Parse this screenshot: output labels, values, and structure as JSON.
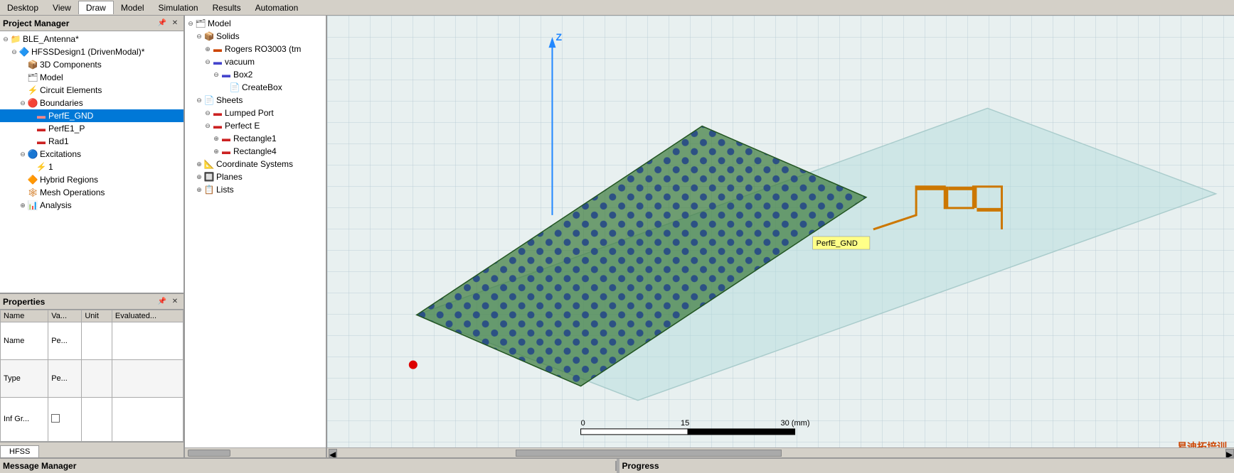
{
  "menubar": {
    "items": [
      "Desktop",
      "View",
      "Draw",
      "Model",
      "Simulation",
      "Results",
      "Automation"
    ]
  },
  "project_manager": {
    "title": "Project Manager",
    "icons": [
      "📌",
      "✕"
    ],
    "tree": [
      {
        "id": "ble_antenna",
        "label": "BLE_Antenna*",
        "indent": 0,
        "toggle": "minus",
        "icon": "folder",
        "icon_color": "blue"
      },
      {
        "id": "hfss_design",
        "label": "HFSSDesign1 (DrivenModal)*",
        "indent": 1,
        "toggle": "minus",
        "icon": "hfss",
        "icon_color": "blue"
      },
      {
        "id": "3d_components",
        "label": "3D Components",
        "indent": 2,
        "toggle": "none",
        "icon": "box",
        "icon_color": "gray"
      },
      {
        "id": "model",
        "label": "Model",
        "indent": 2,
        "toggle": "none",
        "icon": "model",
        "icon_color": "gray"
      },
      {
        "id": "circuit_elements",
        "label": "Circuit Elements",
        "indent": 2,
        "toggle": "none",
        "icon": "circuit",
        "icon_color": "gray"
      },
      {
        "id": "boundaries",
        "label": "Boundaries",
        "indent": 2,
        "toggle": "minus",
        "icon": "boundary",
        "icon_color": "red"
      },
      {
        "id": "perfe_gnd",
        "label": "PerfE_GND",
        "indent": 3,
        "toggle": "none",
        "icon": "sheet",
        "icon_color": "red",
        "selected": true
      },
      {
        "id": "perfe1_p",
        "label": "PerfE1_P",
        "indent": 3,
        "toggle": "none",
        "icon": "sheet",
        "icon_color": "red"
      },
      {
        "id": "rad1",
        "label": "Rad1",
        "indent": 3,
        "toggle": "none",
        "icon": "sheet",
        "icon_color": "red"
      },
      {
        "id": "excitations",
        "label": "Excitations",
        "indent": 2,
        "toggle": "minus",
        "icon": "excitation",
        "icon_color": "blue"
      },
      {
        "id": "exc_1",
        "label": "1",
        "indent": 3,
        "toggle": "none",
        "icon": "port",
        "icon_color": "red"
      },
      {
        "id": "hybrid_regions",
        "label": "Hybrid Regions",
        "indent": 2,
        "toggle": "none",
        "icon": "hybrid",
        "icon_color": "orange"
      },
      {
        "id": "mesh_operations",
        "label": "Mesh Operations",
        "indent": 2,
        "toggle": "none",
        "icon": "mesh",
        "icon_color": "orange"
      },
      {
        "id": "analysis",
        "label": "Analysis",
        "indent": 2,
        "toggle": "plus",
        "icon": "analysis",
        "icon_color": "blue"
      }
    ]
  },
  "properties": {
    "title": "Properties",
    "columns": [
      "Name",
      "Va...",
      "Unit",
      "Evaluated..."
    ],
    "rows": [
      {
        "name": "Name",
        "value": "Pe...",
        "unit": "",
        "evaluated": ""
      },
      {
        "type": "Type",
        "value": "Pe...",
        "unit": "",
        "evaluated": ""
      },
      {
        "name": "Inf Gr...",
        "value": "☐",
        "unit": "",
        "evaluated": ""
      }
    ]
  },
  "hfss_tab": {
    "label": "HFSS"
  },
  "model_tree": {
    "items": [
      {
        "id": "model_root",
        "label": "Model",
        "indent": 0,
        "toggle": "minus"
      },
      {
        "id": "solids",
        "label": "Solids",
        "indent": 1,
        "toggle": "minus"
      },
      {
        "id": "rogers",
        "label": "Rogers RO3003 (tm",
        "indent": 2,
        "toggle": "plus"
      },
      {
        "id": "vacuum",
        "label": "vacuum",
        "indent": 2,
        "toggle": "minus"
      },
      {
        "id": "box2",
        "label": "Box2",
        "indent": 3,
        "toggle": "minus"
      },
      {
        "id": "createbox",
        "label": "CreateBox",
        "indent": 4,
        "toggle": "none"
      },
      {
        "id": "sheets",
        "label": "Sheets",
        "indent": 1,
        "toggle": "minus"
      },
      {
        "id": "lumped_port",
        "label": "Lumped Port",
        "indent": 2,
        "toggle": "minus"
      },
      {
        "id": "perfect_e",
        "label": "Perfect E",
        "indent": 2,
        "toggle": "minus"
      },
      {
        "id": "rectangle1",
        "label": "Rectangle1",
        "indent": 3,
        "toggle": "plus"
      },
      {
        "id": "rectangle4",
        "label": "Rectangle4",
        "indent": 3,
        "toggle": "plus"
      },
      {
        "id": "coord_systems",
        "label": "Coordinate Systems",
        "indent": 1,
        "toggle": "plus"
      },
      {
        "id": "planes",
        "label": "Planes",
        "indent": 1,
        "toggle": "plus"
      },
      {
        "id": "lists",
        "label": "Lists",
        "indent": 1,
        "toggle": "plus"
      }
    ]
  },
  "viewport": {
    "label_perfe_gnd": "PerfE_GND",
    "axis_z": "Z",
    "scale_labels": [
      "0",
      "15",
      "30 (mm)"
    ]
  },
  "bottom_bar": {
    "message_manager": "Message Manager",
    "progress": "Progress"
  },
  "watermark": "易迪拓培训"
}
